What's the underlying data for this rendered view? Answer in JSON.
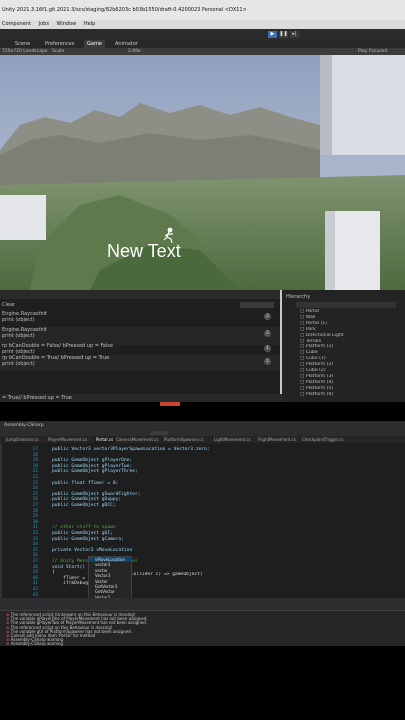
{
  "unity": {
    "title": "Unity 2021.3.16f1.git.2021.3/scs/staging/82b6203c b03b1550/draft-0.4200023 Personal <DX11>",
    "menu": [
      "Component",
      "Jobs",
      "Window",
      "Help"
    ],
    "tabs": [
      "Scene",
      "Preferences",
      "Game",
      "Animator"
    ],
    "gamebar": {
      "aspect": "720x720 Landscape",
      "scale_label": "Scale",
      "scale_value": "2.89x",
      "play_mode": "Play Focused"
    },
    "game_text": "New Text",
    "console": {
      "header": "Clear",
      "lines": [
        {
          "text": "Engine.Raycasthit",
          "sub": "print (object)"
        },
        {
          "text": "Engine.Raycasthit",
          "sub": "print (object)"
        },
        {
          "text": "rp bCanDouble = False/ bPressed up = False",
          "sub": "print (object)"
        },
        {
          "text": "rp bCanDouble = True/ bPressed up = True",
          "sub": "print (object)"
        }
      ],
      "counts": [
        "2",
        "2",
        "1",
        "1"
      ],
      "status": "= True// bPressed up = True"
    },
    "hierarchy": {
      "tab": "Hierarchy",
      "items": [
        "Portal",
        "Wall",
        "Portal (1)",
        "Park",
        "Directional Light",
        "Terrain",
        "Platform (1)",
        "Cube",
        "Cube (1)",
        "Platform (2)",
        "Cube (2)",
        "Platform (3)",
        "Platform (4)",
        "Platform (5)",
        "Platform (6)"
      ]
    }
  },
  "vs": {
    "title": "Assembly-CSharp",
    "tabs": [
      "JumpDetector.cs",
      "PlayerMovement.cs",
      "Portal.cs",
      "CameraMovement.cs",
      "PlatformSpawner.cs",
      "LightMovement.cs",
      "FlightMovement.cs",
      "CheckpointTrigger.cs"
    ],
    "code": [
      {
        "n": "17",
        "t": "public Vector3 vector3PlayerSpawnLocation = Vector3.zero;",
        "k": "field"
      },
      {
        "n": "18",
        "t": "",
        "k": ""
      },
      {
        "n": "19",
        "t": "public GameObject gPlayerOne;",
        "k": "field"
      },
      {
        "n": "20",
        "t": "public GameObject gPlayerTwo;",
        "k": "field"
      },
      {
        "n": "21",
        "t": "public GameObject gPlayerThree;",
        "k": "field"
      },
      {
        "n": "22",
        "t": "",
        "k": ""
      },
      {
        "n": "23",
        "t": "public float fTimer = 0;",
        "k": "field"
      },
      {
        "n": "24",
        "t": "",
        "k": ""
      },
      {
        "n": "25",
        "t": "public GameObject gSwordFighter;",
        "k": "field"
      },
      {
        "n": "26",
        "t": "public GameObject gGuppy;",
        "k": "field"
      },
      {
        "n": "27",
        "t": "public GameObject gDCC;",
        "k": "field"
      },
      {
        "n": "28",
        "t": "",
        "k": ""
      },
      {
        "n": "29",
        "t": "",
        "k": ""
      },
      {
        "n": "30",
        "t": "",
        "k": ""
      },
      {
        "n": "31",
        "t": "// other stuff to spawn",
        "k": "comment"
      },
      {
        "n": "32",
        "t": "public GameObject gUI;",
        "k": "field"
      },
      {
        "n": "33",
        "t": "public GameObject gCamera;",
        "k": "field"
      },
      {
        "n": "34",
        "t": "",
        "k": ""
      },
      {
        "n": "35",
        "t": "private Vector3 vMoveLocation",
        "k": "field"
      },
      {
        "n": "36",
        "t": "",
        "k": ""
      },
      {
        "n": "37",
        "t": "// Unity Message | 0 references",
        "k": "comment"
      },
      {
        "n": "38",
        "t": "void Start()",
        "k": "field"
      },
      {
        "n": "39",
        "t": "{",
        "k": ""
      },
      {
        "n": "40",
        "t": "    fTimer = 0;",
        "k": ""
      },
      {
        "n": "41",
        "t": "    if(bDebug==",
        "k": ""
      },
      {
        "n": "42",
        "t": "",
        "k": ""
      },
      {
        "n": "43",
        "t": "",
        "k": ""
      }
    ],
    "code_right": "(Collider c) => gameObject)",
    "autocomplete": {
      "title": "vMoveLocation",
      "items": [
        "vector3",
        "vector",
        "Vector3",
        "Vector",
        "GetVector3",
        "GetVector",
        "Vector2"
      ]
    },
    "error_rows": [
      "The referenced script (Unknown) on this Behaviour is missing!",
      "The variable gPlayerOne of PlayerMovement has not been assigned.",
      "The variable gPlayerTwo of PlayerMovement has not been assigned.",
      "The referenced script on this Behaviour is missing!",
      "The variable gUI of PlatformSpawner has not been assigned.",
      "Cannot add menu item 'Portal' for method",
      "Assembly-CSharp warning",
      "Assembly-CSharp warning"
    ]
  }
}
